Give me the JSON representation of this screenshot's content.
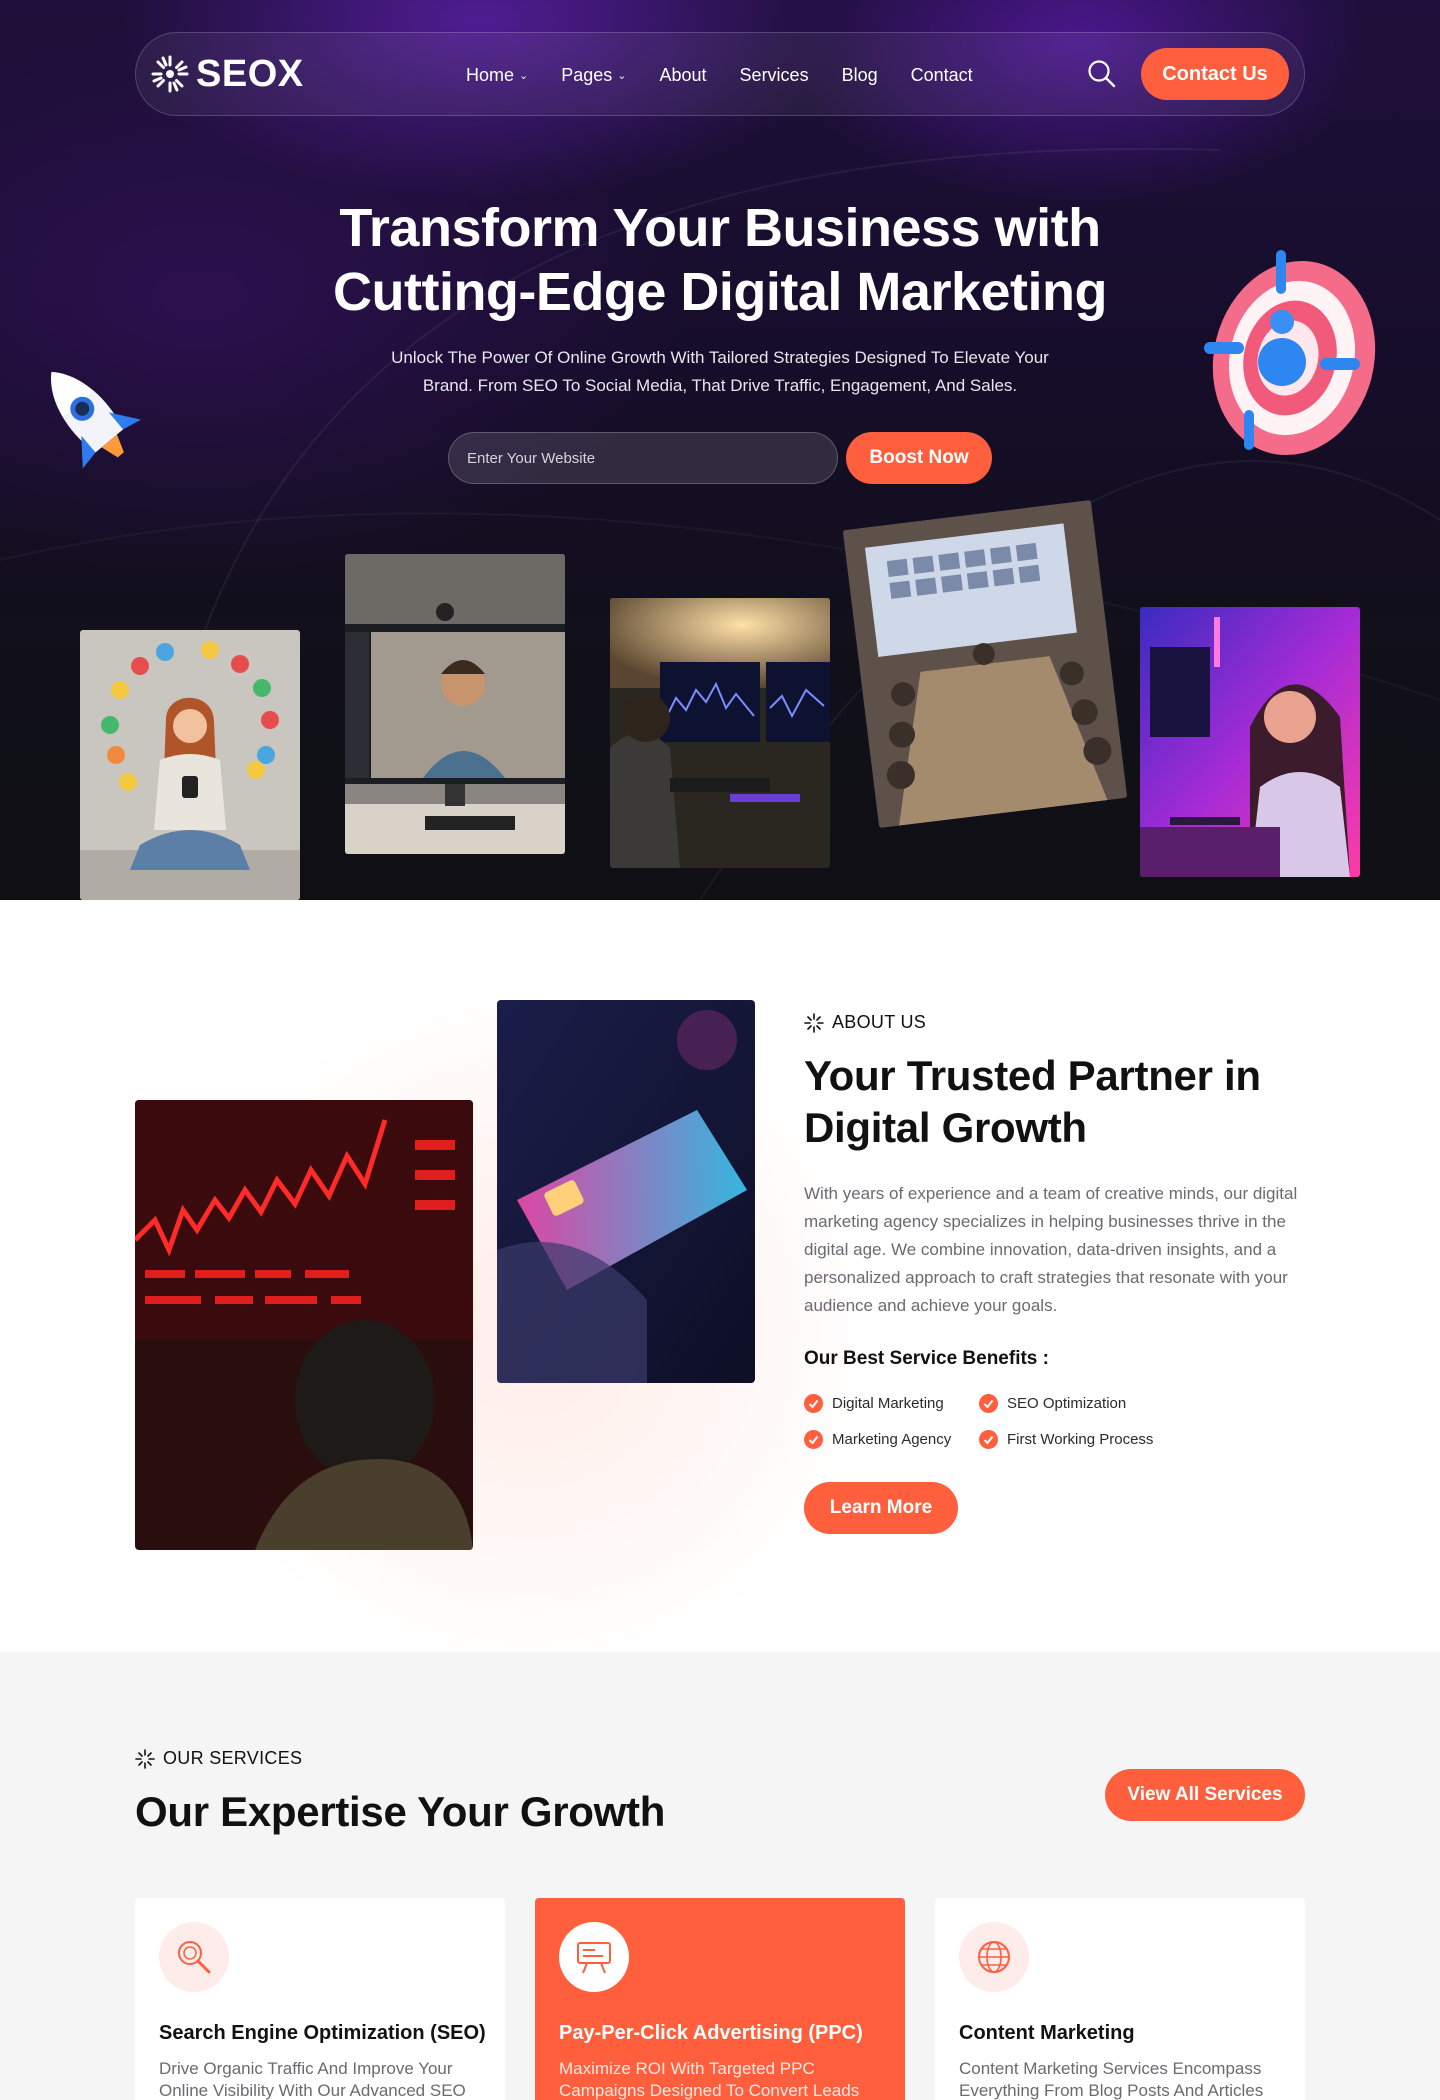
{
  "brand": {
    "name": "SEOX",
    "accent": "#ff5f3d"
  },
  "nav": {
    "items": [
      {
        "label": "Home",
        "has_dropdown": true
      },
      {
        "label": "Pages",
        "has_dropdown": true
      },
      {
        "label": "About",
        "has_dropdown": false
      },
      {
        "label": "Services",
        "has_dropdown": false
      },
      {
        "label": "Blog",
        "has_dropdown": false
      },
      {
        "label": "Contact",
        "has_dropdown": false
      }
    ],
    "search_icon": "search-icon",
    "cta_label": "Contact Us"
  },
  "hero": {
    "title_line1": "Transform Your Business with",
    "title_line2": "Cutting-Edge Digital Marketing",
    "subtitle_line1": "Unlock The Power Of Online Growth With Tailored Strategies Designed To Elevate Your",
    "subtitle_line2": "Brand. From SEO To Social Media, That Drive Traffic, Engagement, And Sales.",
    "input_placeholder": "Enter Your Website",
    "button_label": "Boost Now"
  },
  "about": {
    "tag": "ABOUT US",
    "title_line1": "Your Trusted Partner in",
    "title_line2": "Digital Growth",
    "text": "With years of experience and a team of creative minds, our digital marketing agency specializes in helping businesses thrive in the digital age. We combine innovation, data-driven insights, and a personalized approach to craft strategies that resonate with your audience and achieve your goals.",
    "benefits_title": "Our Best Service Benefits :",
    "benefits": [
      "Digital Marketing",
      "SEO Optimization",
      "Marketing Agency",
      "First Working Process"
    ],
    "button_label": "Learn More"
  },
  "services": {
    "tag": "OUR SERVICES",
    "title": "Our Expertise Your Growth",
    "view_all_label": "View All Services",
    "cards": [
      {
        "title": "Search Engine Optimization (SEO)",
        "text": "Drive Organic Traffic And Improve Your Online Visibility With Our Advanced SEO",
        "icon": "magnifier-icon",
        "active": false
      },
      {
        "title": "Pay-Per-Click Advertising (PPC)",
        "text": "Maximize ROI With Targeted PPC Campaigns Designed To Convert Leads",
        "icon": "billboard-icon",
        "active": true
      },
      {
        "title": "Content Marketing",
        "text": "Content Marketing Services Encompass Everything From Blog Posts And Articles",
        "icon": "globe-icon",
        "active": false
      }
    ]
  }
}
